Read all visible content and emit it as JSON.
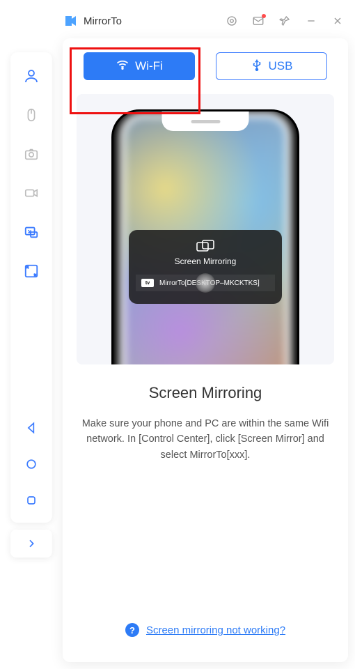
{
  "titlebar": {
    "app_name": "MirrorTo"
  },
  "tabs": {
    "wifi_label": "Wi-Fi",
    "usb_label": "USB"
  },
  "phone_sheet": {
    "title": "Screen Mirroring",
    "device_row": "MirrorTo[DESKTOP–MKCKTKS]",
    "tv_badge": "tv"
  },
  "section": {
    "title": "Screen Mirroring",
    "description": "Make sure your phone and PC are within the same Wifi network. In [Control Center], click [Screen Mirror] and select MirrorTo[xxx]."
  },
  "help_link": {
    "text": "Screen mirroring not working?"
  },
  "colors": {
    "accent": "#2d7bf6",
    "highlight": "#e11"
  }
}
